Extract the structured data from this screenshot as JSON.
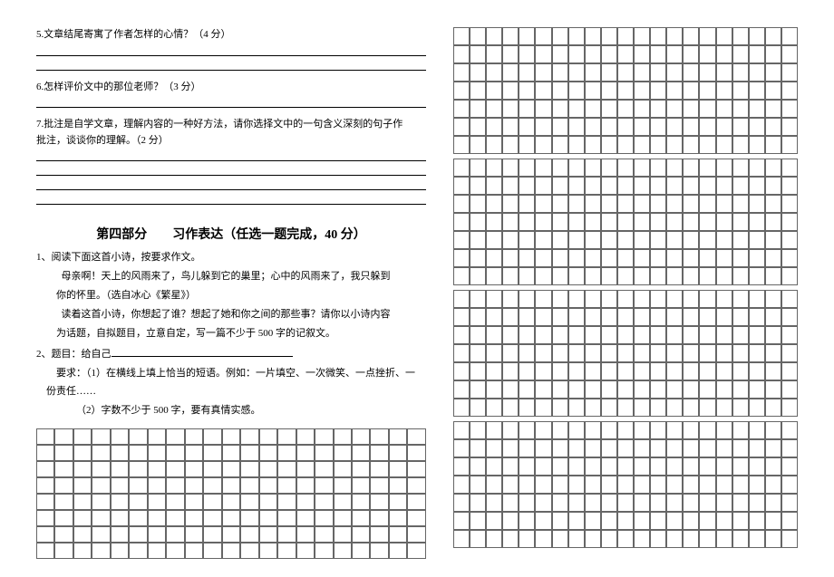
{
  "q5": {
    "text": "5.文章结尾寄寓了作者怎样的心情？（4 分）"
  },
  "q6": {
    "text": "6.怎样评价文中的那位老师？（3 分）"
  },
  "q7": {
    "text1": "7.批注是自学文章，理解内容的一种好方法，请你选择文中的一句含义深刻的句子作",
    "text2": "批注，谈谈你的理解。（2 分）"
  },
  "section4": {
    "title": "第四部分　　习作表达（任选一题完成，40 分）"
  },
  "essay1": {
    "intro": "1、阅读下面这首小诗，按要求作文。",
    "line1": "母亲啊！天上的风雨来了，鸟儿躲到它的巢里；心中的风雨来了，我只躲到",
    "line2": "你的怀里。（选自冰心《繁星》）",
    "line3": "读着这首小诗，你想起了谁？想起了她和你之间的那些事？请你以小诗内容",
    "line4": "为话题，自拟题目，立意自定，写一篇不少于 500 字的记叙文。"
  },
  "essay2": {
    "intro": "2、题目：给自己",
    "req1": "要求：（1）在横线上填上恰当的短语。例如：一片填空、一次微笑、一点挫折、一",
    "req1b": "份责任……",
    "req2": "（2）字数不少于 500 字，要有真情实感。"
  },
  "grid": {
    "leftRows": 8,
    "leftCols": 21,
    "rightBlocks": 4,
    "rightRowsPerBlock": 7,
    "rightCols": 21
  }
}
